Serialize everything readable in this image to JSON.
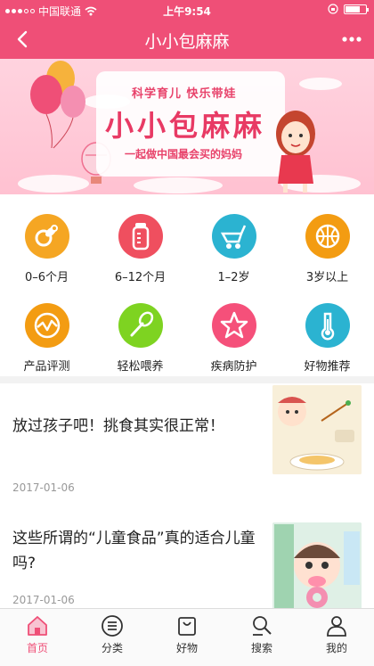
{
  "status_bar": {
    "carrier": "中国联通",
    "time": "上午9:54"
  },
  "nav": {
    "title": "小小包麻麻"
  },
  "banner": {
    "line1": "科学育儿  快乐带娃",
    "title": "小小包麻麻",
    "line2": "一起做中国最会买的妈妈"
  },
  "categories": [
    {
      "label": "0–6个月",
      "icon": "pacifier-icon",
      "color": "#f5a623"
    },
    {
      "label": "6–12个月",
      "icon": "baby-bottle-icon",
      "color": "#ef4f5f"
    },
    {
      "label": "1–2岁",
      "icon": "stroller-icon",
      "color": "#2bb3d1"
    },
    {
      "label": "3岁以上",
      "icon": "ball-icon",
      "color": "#f39c12"
    },
    {
      "label": "产品评测",
      "icon": "chart-icon",
      "color": "#f39c12"
    },
    {
      "label": "轻松喂养",
      "icon": "spoon-icon",
      "color": "#7ed321"
    },
    {
      "label": "疾病防护",
      "icon": "star-icon",
      "color": "#f5507a"
    },
    {
      "label": "好物推荐",
      "icon": "thermometer-icon",
      "color": "#2bb3d1"
    }
  ],
  "articles": [
    {
      "title": "放过孩子吧！挑食其实很正常！",
      "date": "2017-01-06"
    },
    {
      "title": "这些所谓的“儿童食品”真的适合儿童吗?",
      "date": "2017-01-06"
    }
  ],
  "tabs": [
    {
      "label": "首页",
      "icon": "home-icon"
    },
    {
      "label": "分类",
      "icon": "list-icon"
    },
    {
      "label": "好物",
      "icon": "bag-icon"
    },
    {
      "label": "搜索",
      "icon": "search-icon"
    },
    {
      "label": "我的",
      "icon": "user-icon"
    }
  ],
  "colors": {
    "brand": "#ef4f77",
    "active_tab": "#ef4f77"
  }
}
